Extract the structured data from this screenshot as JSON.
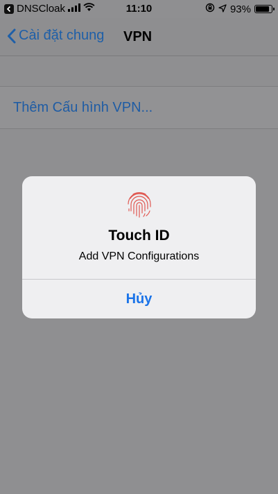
{
  "status_bar": {
    "carrier": "DNSCloak",
    "time": "11:10",
    "battery_percent": "93%",
    "battery_level": 0.93,
    "icons": [
      "back-to-app-icon",
      "signal-icon",
      "wifi-icon",
      "orientation-lock-icon",
      "location-arrow-icon",
      "battery-icon"
    ]
  },
  "nav": {
    "back_label": "Cài đặt chung",
    "title": "VPN"
  },
  "list": {
    "add_vpn_label": "Thêm Cấu hình VPN..."
  },
  "dialog": {
    "icon": "fingerprint-icon",
    "title": "Touch ID",
    "message": "Add VPN Configurations",
    "cancel_label": "Hủy"
  },
  "colors": {
    "accent": "#1a73e8",
    "dimmed_background": "#8f8f91",
    "dialog_background": "#efeff1",
    "fingerprint": "#e0564f"
  }
}
